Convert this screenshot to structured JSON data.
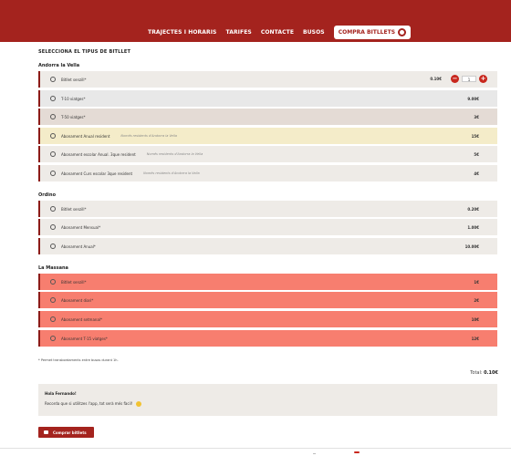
{
  "nav": {
    "links": [
      "TRAJECTES I HORARIS",
      "TARIFES",
      "CONTACTE",
      "BUSOS"
    ],
    "cta": "COMPRA BITLLETS"
  },
  "heading": "SELECCIONA EL TIPUS DE BITLLET",
  "sections": [
    {
      "title": "Andorra la Vella",
      "rows": [
        {
          "label": "Bitllet senzill*",
          "note": "",
          "price": "",
          "bg": "#eeebe7"
        },
        {
          "label": "T-10 viatges*",
          "note": "",
          "price": "9.00€",
          "bg": "#e8e8e8"
        },
        {
          "label": "T-50 viatges*",
          "note": "",
          "price": "3€",
          "bg": "#e4dbd5"
        },
        {
          "label": "Abonament Anual resident",
          "note": "Només residents d'Andorra la Vella",
          "price": "15€",
          "bg": "#f4ecc9"
        },
        {
          "label": "Abonament escolar Anual. 3que resident",
          "note": "Només residents d'Andorra la Vella",
          "price": "5€",
          "bg": "#eeebe7"
        },
        {
          "label": "Abonament Curs escolar 3que resident",
          "note": "Només residents d'Andorra la Vella",
          "price": "4€",
          "bg": "#eeebe7"
        }
      ]
    },
    {
      "title": "Ordino",
      "rows": [
        {
          "label": "Bitllet senzill*",
          "note": "",
          "price": "0.20€",
          "bg": "#eeebe7"
        },
        {
          "label": "Abonament Mensual*",
          "note": "",
          "price": "1.00€",
          "bg": "#eeebe7"
        },
        {
          "label": "Abonament Anual*",
          "note": "",
          "price": "10.00€",
          "bg": "#eeebe7"
        }
      ]
    },
    {
      "title": "La Massana",
      "rows": [
        {
          "label": "Bitllet senzill*",
          "note": "",
          "price": "1€",
          "bg": "#f77e6f"
        },
        {
          "label": "Abonament diari*",
          "note": "",
          "price": "2€",
          "bg": "#f77e6f"
        },
        {
          "label": "Abonament setmanal*",
          "note": "",
          "price": "10€",
          "bg": "#f77e6f"
        },
        {
          "label": "Abonament T-15 viatges*",
          "note": "",
          "price": "12€",
          "bg": "#f77e6f"
        }
      ]
    }
  ],
  "quantity_control": {
    "price": "0.10€",
    "value": "1",
    "minus": "−",
    "plus": "+"
  },
  "footnote": "* Permet transbordaments entre busos durant 1h.",
  "total": {
    "label": "Total:",
    "value": "0.10€"
  },
  "message": {
    "title": "Hola Fernando!",
    "text": "Recorda que si utilitzes l'app, tot serà més fàcil!"
  },
  "buy_button": "Comprar bitllets",
  "colors": {
    "brand": "#a4231e",
    "accent": "#c8271d"
  }
}
